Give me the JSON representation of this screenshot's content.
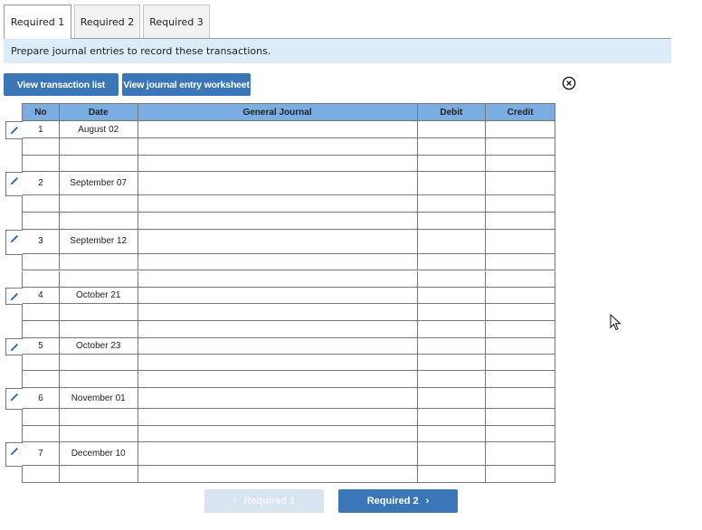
{
  "tabs": [
    {
      "label": "Required 1",
      "active": true
    },
    {
      "label": "Required 2",
      "active": false
    },
    {
      "label": "Required 3",
      "active": false
    }
  ],
  "instruction": "Prepare journal entries to record these transactions.",
  "buttons": {
    "view_transaction_list": "View transaction list",
    "view_journal_entry_worksheet": "View journal entry worksheet"
  },
  "close_icon": "circle-x-icon",
  "table": {
    "headers": {
      "no": "No",
      "date": "Date",
      "general_journal": "General Journal",
      "debit": "Debit",
      "credit": "Credit"
    },
    "entries": [
      {
        "no": "1",
        "date": "August 02",
        "lines": 3
      },
      {
        "no": "2",
        "date": "September 07",
        "lines": 3
      },
      {
        "no": "3",
        "date": "September 12",
        "lines": 3
      },
      {
        "no": "4",
        "date": "October 21",
        "lines": 3
      },
      {
        "no": "5",
        "date": "October 23",
        "lines": 3
      },
      {
        "no": "6",
        "date": "November 01",
        "lines": 3
      },
      {
        "no": "7",
        "date": "December 10",
        "lines": 2
      }
    ],
    "edit_icon": "pencil-icon"
  },
  "nav": {
    "prev_label": "Required 1",
    "prev_enabled": false,
    "next_label": "Required 2",
    "next_enabled": true
  },
  "colors": {
    "accent": "#3a76b8",
    "header_bg": "#7aaee3",
    "instruction_bg": "#dcecf9",
    "disabled_btn": "#d9e4f1"
  }
}
